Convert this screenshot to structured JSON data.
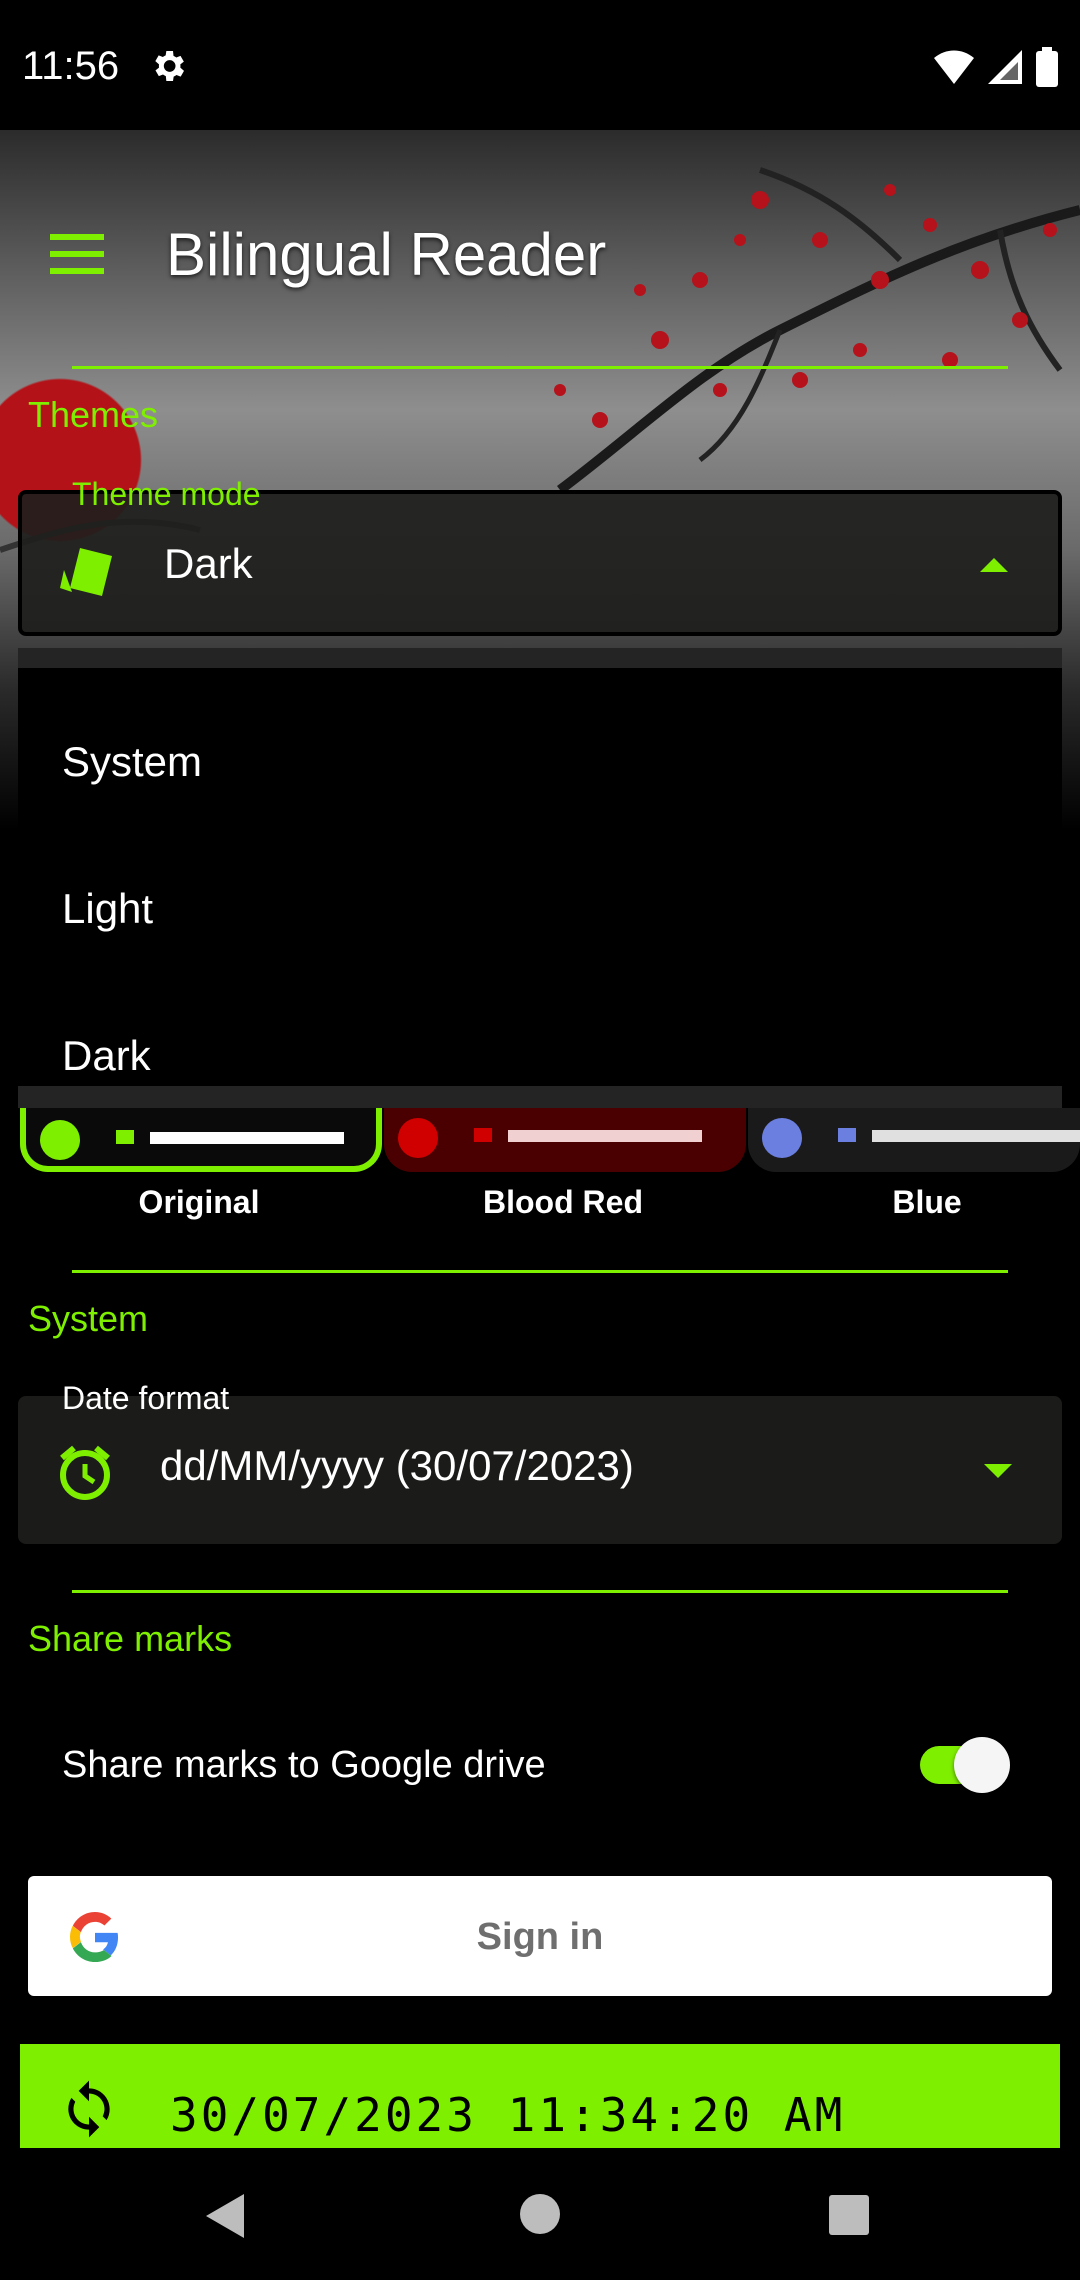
{
  "status_bar": {
    "time": "11:56"
  },
  "toolbar": {
    "title": "Bilingual Reader"
  },
  "themes": {
    "section_title": "Themes",
    "theme_mode": {
      "label": "Theme mode",
      "value": "Dark",
      "options": [
        "System",
        "Light",
        "Dark"
      ]
    },
    "color_themes": [
      {
        "name": "Original",
        "color": "#7fef00",
        "selected": true
      },
      {
        "name": "Blood Red",
        "color": "#d10000",
        "selected": false
      },
      {
        "name": "Blue",
        "color": "#6b7fe0",
        "selected": false
      }
    ]
  },
  "system": {
    "section_title": "System",
    "date_format": {
      "label": "Date format",
      "value": "dd/MM/yyyy (30/07/2023)"
    }
  },
  "share_marks": {
    "section_title": "Share marks",
    "toggle_label": "Share marks to Google drive",
    "toggle_on": true,
    "sign_in_label": "Sign in",
    "last_sync": "30/07/2023 11:34:20 AM"
  },
  "colors": {
    "accent": "#7fef00",
    "background": "#000000"
  }
}
